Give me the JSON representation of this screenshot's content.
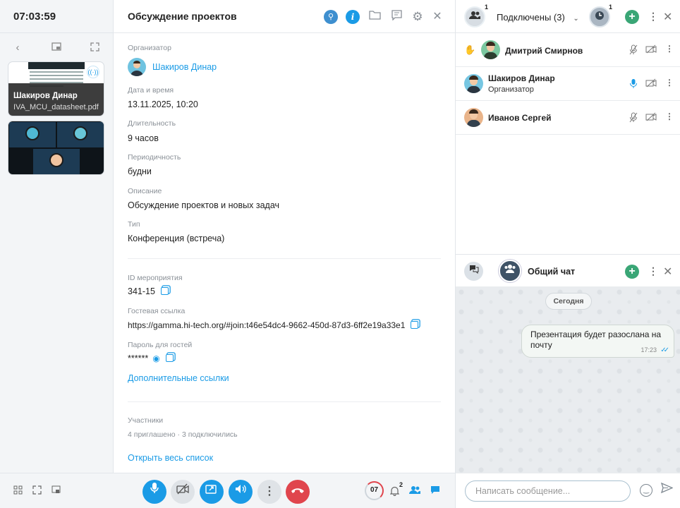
{
  "clock": "07:03:59",
  "left_panel": {
    "tiles": [
      {
        "name": "Шакиров Динар",
        "file": "IVA_MCU_datasheet.pdf"
      }
    ]
  },
  "meeting": {
    "title": "Обсуждение проектов",
    "organizer_label": "Организатор",
    "organizer_name": "Шакиров Динар",
    "datetime_label": "Дата и время",
    "datetime_value": "13.11.2025, 10:20",
    "duration_label": "Длительность",
    "duration_value": "9 часов",
    "periodicity_label": "Периодичность",
    "periodicity_value": "будни",
    "description_label": "Описание",
    "description_value": "Обсуждение проектов и новых задач",
    "type_label": "Тип",
    "type_value": "Конференция (встреча)",
    "event_id_label": "ID мероприятия",
    "event_id_value": "341-15",
    "guest_link_label": "Гостевая ссылка",
    "guest_link_value": "https://gamma.hi-tech.org/#join:t46e54dc4-9662-450d-87d3-6ff2e19a33e1",
    "guest_password_label": "Пароль для гостей",
    "guest_password_value": "******",
    "extra_links": "Дополнительные ссылки",
    "participants_label": "Участники",
    "participants_summary": "4 приглашено · 3 подключились",
    "open_full_list": "Открыть весь список"
  },
  "right_panel": {
    "people_badge": "1",
    "connected_label": "Подключены (3)",
    "clock_badge": "1",
    "participants": [
      {
        "name": "Дмитрий Смирнов",
        "role": ""
      },
      {
        "name": "Шакиров Динар",
        "role": "Организатор"
      },
      {
        "name": "Иванов Сергей",
        "role": ""
      }
    ],
    "chat": {
      "title": "Общий чат",
      "date_separator": "Сегодня",
      "message_text": "Презентация будет разослана на почту",
      "message_time": "17:23",
      "input_placeholder": "Написать сообщение..."
    }
  },
  "bottom_bar": {
    "timer": "07",
    "notifications_badge": "2"
  },
  "colors": {
    "accent": "#1a9be6",
    "hangup": "#e0454d",
    "add": "#3aa676"
  }
}
